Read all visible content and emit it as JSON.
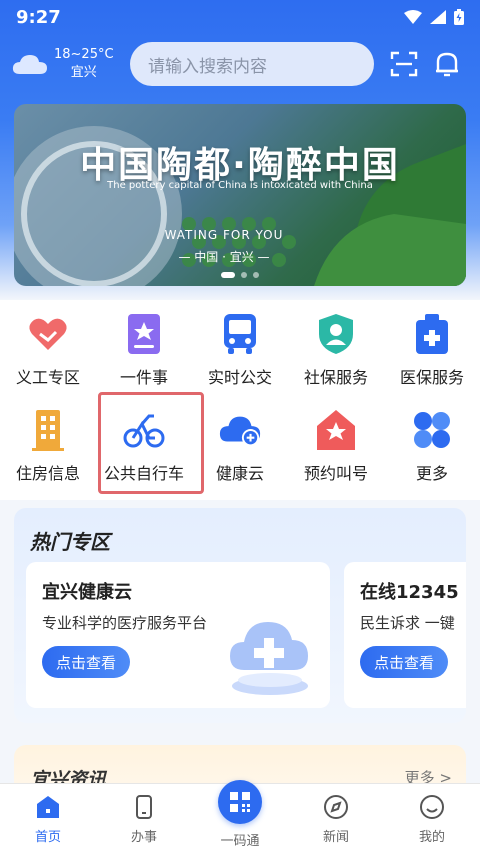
{
  "status_bar": {
    "time": "9:27"
  },
  "header": {
    "weather": {
      "temp": "18~25°C",
      "city": "宜兴"
    },
    "search_placeholder": "请输入搜索内容"
  },
  "banner": {
    "title": "中国陶都·陶醉中国",
    "subtitle": "The pottery capital of China is intoxicated with China",
    "tagline": "WATING FOR YOU",
    "tagline2": "— 中国 · 宜兴 —"
  },
  "services": [
    {
      "label": "义工专区",
      "icon": "handshake-icon",
      "color": "#f06a6a"
    },
    {
      "label": "一件事",
      "icon": "star-document-icon",
      "color": "#8a6bf0"
    },
    {
      "label": "实时公交",
      "icon": "bus-icon",
      "color": "#2d6bf0"
    },
    {
      "label": "社保服务",
      "icon": "shield-user-icon",
      "color": "#2bb8a6"
    },
    {
      "label": "医保服务",
      "icon": "medical-kit-icon",
      "color": "#2d6bf0"
    },
    {
      "label": "住房信息",
      "icon": "building-icon",
      "color": "#f0a93a"
    },
    {
      "label": "公共自行车",
      "icon": "bicycle-icon",
      "color": "#2d6bf0"
    },
    {
      "label": "健康云",
      "icon": "cloud-plus-icon",
      "color": "#2d6bf0"
    },
    {
      "label": "预约叫号",
      "icon": "house-star-icon",
      "color": "#ef5b5b"
    },
    {
      "label": "更多",
      "icon": "grid-more-icon",
      "color": "#2d6bf0"
    }
  ],
  "hot_section": {
    "title": "热门专区",
    "cards": [
      {
        "title": "宜兴健康云",
        "desc": "专业科学的医疗服务平台",
        "button": "点击查看"
      },
      {
        "title": "在线12345",
        "desc": "民生诉求 一键",
        "button": "点击查看"
      }
    ]
  },
  "news_section": {
    "title": "宜兴资讯",
    "more": "更多 >"
  },
  "tabbar": [
    {
      "label": "首页",
      "icon": "home-icon",
      "active": true
    },
    {
      "label": "办事",
      "icon": "phone-icon",
      "active": false
    },
    {
      "label": "一码通",
      "icon": "qrcode-icon",
      "active": false
    },
    {
      "label": "新闻",
      "icon": "compass-icon",
      "active": false
    },
    {
      "label": "我的",
      "icon": "smile-icon",
      "active": false
    }
  ],
  "colors": {
    "primary": "#2d6bf0",
    "highlight_border": "#e0676b"
  }
}
